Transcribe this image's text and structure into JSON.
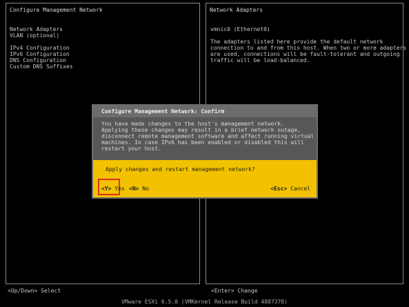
{
  "left_panel": {
    "title": "Configure Management Network",
    "groups": [
      [
        "Network Adapters",
        "VLAN (optional)"
      ],
      [
        "IPv4 Configuration",
        "IPv6 Configuration",
        "DNS Configuration",
        "Custom DNS Suffixes"
      ]
    ]
  },
  "right_panel": {
    "title": "Network Adapters",
    "value": "vmnic0 (Ethernet0)",
    "description": "The adapters listed here provide the default network\nconnection to and from this host. When two or more adapters\nare used, connections will be fault-tolerant and outgoing\ntraffic will be load-balanced."
  },
  "dialog": {
    "title": "Configure Management Network: Confirm",
    "message": "You have made changes to the host's management network.\nApplying these changes may result in a brief network outage,\ndisconnect remote management software and affect running virtual\nmachines. In case IPv6 has been enabled or disabled this will\nrestart your host.",
    "prompt": "Apply changes and restart management network?",
    "yes_key": "<Y>",
    "yes_label": "Yes",
    "no_key": "<N>",
    "no_label": "No",
    "esc_key": "<Esc>",
    "esc_label": "Cancel"
  },
  "footer": {
    "left": "<Up/Down> Select",
    "right": "<Enter> Change"
  },
  "status_bar": "VMware ESXi 6.5.0 (VMKernel Release Build 4887370)",
  "colors": {
    "background": "#000000",
    "dialog_accent": "#f2c200",
    "highlight_box": "#e0301e"
  }
}
